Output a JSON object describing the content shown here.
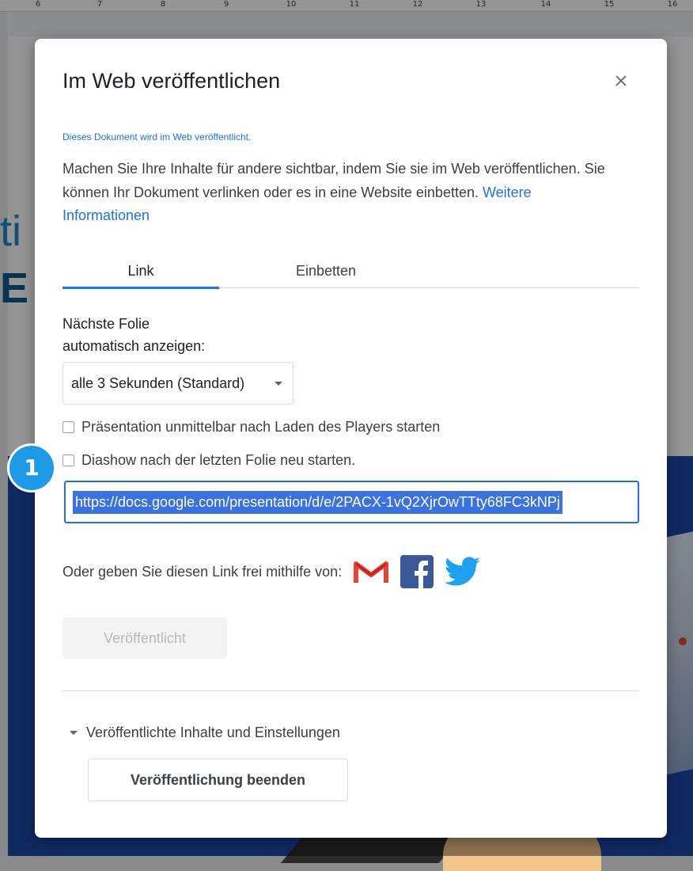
{
  "ruler": {
    "numbers": [
      "6",
      "7",
      "8",
      "9",
      "10",
      "11",
      "12",
      "13",
      "14",
      "15",
      "16"
    ]
  },
  "slide": {
    "heading_line1": "ti",
    "heading_line2": "E"
  },
  "dialog": {
    "title": "Im Web veröffentlichen",
    "close_icon": "close-icon",
    "note": "Dieses Dokument wird im Web veröffentlicht.",
    "description": "Machen Sie Ihre Inhalte für andere sichtbar, indem Sie sie im Web veröffentlichen. Sie können Ihr Dokument verlinken oder es in eine Website einbetten. ",
    "learn_more": "Weitere Informationen",
    "tabs": [
      {
        "label": "Link",
        "selected": true
      },
      {
        "label": "Einbetten",
        "selected": false
      }
    ],
    "advance_label_line1": "Nächste Folie",
    "advance_label_line2": "automatisch anzeigen:",
    "advance_select": "alle 3 Sekunden (Standard)",
    "options": [
      {
        "label": "Präsentation unmittelbar nach Laden des Players starten",
        "checked": false
      },
      {
        "label": "Diashow nach der letzten Folie neu starten.",
        "checked": false
      }
    ],
    "url": "https://docs.google.com/presentation/d/e/2PACX-1vQ2XjrOwTTty68FC3kNPj",
    "share_label": "Oder geben Sie diesen Link frei mithilfe von:",
    "share_icons": [
      "gmail-icon",
      "facebook-icon",
      "twitter-icon"
    ],
    "published_button": "Veröffentlicht",
    "published_settings_label": "Veröffentlichte Inhalte und Einstellungen",
    "stop_button": "Veröffentlichung beenden"
  },
  "annotation": {
    "badge": "1"
  },
  "colors": {
    "accent": "#1a73e8",
    "badge": "#1d9be6",
    "gmail_red": "#ea4335",
    "facebook_blue": "#3b5998",
    "twitter_blue": "#1da1f2"
  }
}
